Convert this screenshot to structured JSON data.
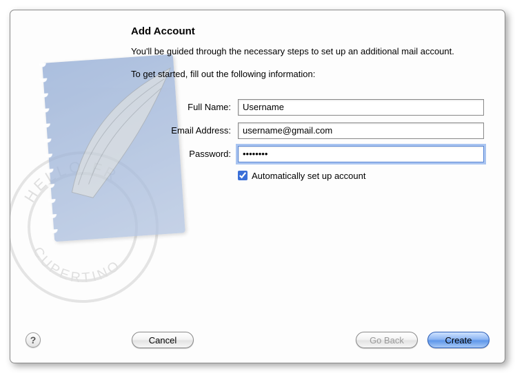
{
  "dialog": {
    "title": "Add Account",
    "intro1": "You'll be guided through the necessary steps to set up an additional mail account.",
    "intro2": "To get started, fill out the following information:"
  },
  "form": {
    "fullname_label": "Full Name:",
    "fullname_value": "Username",
    "email_label": "Email Address:",
    "email_value": "username@gmail.com",
    "password_label": "Password:",
    "password_value": "••••••••",
    "auto_checkbox_label": "Automatically set up account",
    "auto_checkbox_checked": true
  },
  "buttons": {
    "help": "?",
    "cancel": "Cancel",
    "goback": "Go Back",
    "create": "Create"
  },
  "artwork": {
    "postmark_top": "HELLO FR",
    "postmark_bottom": "CUPERTINO"
  }
}
